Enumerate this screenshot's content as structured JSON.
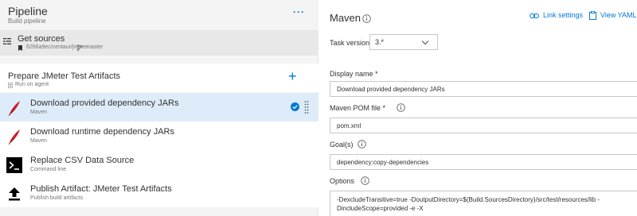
{
  "pipeline": {
    "title": "Pipeline",
    "subtitle": "Build pipeline",
    "more_label": "···"
  },
  "get_sources": {
    "title": "Get sources",
    "repo": "6266a9ec/centaur/jmeter",
    "branch": "master"
  },
  "job": {
    "title": "Prepare JMeter Test Artifacts",
    "subtitle": "Run on agent",
    "add_label": "+"
  },
  "tasks": [
    {
      "title": "Download provided dependency JARs",
      "subtitle": "Maven",
      "icon": "maven-feather-icon",
      "selected": true
    },
    {
      "title": "Download runtime dependency JARs",
      "subtitle": "Maven",
      "icon": "maven-feather-icon",
      "selected": false
    },
    {
      "title": "Replace CSV Data Source",
      "subtitle": "Command line",
      "icon": "command-line-icon",
      "selected": false
    },
    {
      "title": "Publish Artifact: JMeter Test Artifacts",
      "subtitle": "Publish build artifacts",
      "icon": "publish-upload-icon",
      "selected": false
    }
  ],
  "detail": {
    "title": "Maven",
    "link_settings": "Link settings",
    "view_yaml": "View YAML",
    "task_version_label": "Task version",
    "task_version_value": "3.*",
    "display_name_label": "Display name *",
    "display_name_value": "Download provided dependency JARs",
    "pom_label": "Maven POM file *",
    "pom_value": "pom.xml",
    "goals_label": "Goal(s)",
    "goals_value": "dependency:copy-dependencies",
    "options_label": "Options",
    "options_value": "-DexcludeTransitive=true -DoutputDirectory=$(Build.SourcesDirectory)/src/test/resources/lib -DincludeScope=provided -e -X"
  },
  "colors": {
    "accent": "#0078d4",
    "selected_bg": "#deecf9",
    "maven_red": "#c7202c"
  }
}
